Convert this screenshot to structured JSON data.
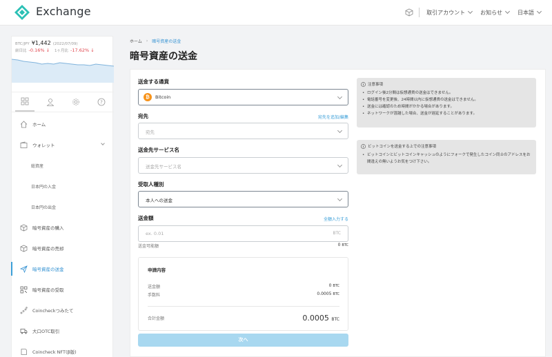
{
  "header": {
    "brand": "Exchange",
    "menus": [
      {
        "label": "取引アカウント"
      },
      {
        "label": "お知らせ"
      },
      {
        "label": "日本語"
      }
    ]
  },
  "rate": {
    "label1": "BTC/JPY",
    "price": "¥1,442",
    "date": "(2022/07/09)",
    "label2": "前日比",
    "change1": "-0.16% ↓",
    "label3": "1ヶ月比",
    "change2": "-17.62% ↓"
  },
  "sidebar": {
    "items": [
      {
        "label": "ホーム",
        "icon": "home-icon"
      },
      {
        "label": "ウォレット",
        "icon": "wallet-icon"
      },
      {
        "label": "総資産",
        "sub": true
      },
      {
        "label": "日本円の入金",
        "sub": true
      },
      {
        "label": "日本円の出金",
        "sub": true
      },
      {
        "label": "暗号資産の購入",
        "icon": "cube-icon"
      },
      {
        "label": "暗号資産の売却",
        "icon": "cube-icon"
      },
      {
        "label": "暗号資産の送金",
        "icon": "send-icon",
        "active": true
      },
      {
        "label": "暗号資産の受取",
        "icon": "qr-icon"
      },
      {
        "label": "Coincheckつみたて",
        "icon": "chart-icon"
      },
      {
        "label": "大口OTC取引",
        "icon": "truck-icon"
      },
      {
        "label": "Coincheck NFT(β版)",
        "icon": "nft-icon"
      }
    ]
  },
  "breadcrumb": {
    "home": "ホーム",
    "current": "暗号資産の送金"
  },
  "page_title": "暗号資産の送金",
  "form": {
    "currency_label": "送金する通貨",
    "currency_value": "Bitcoin",
    "dest_label": "宛先",
    "dest_link": "宛先を追加/編集",
    "dest_placeholder": "宛先",
    "service_label": "送金先サービス名",
    "service_placeholder": "送金先サービス名",
    "recipient_label": "受取人種別",
    "recipient_value": "本人への送金",
    "amount_label": "送金額",
    "amount_link": "全額入力する",
    "amount_placeholder": "ex. 0.01",
    "amount_unit": "BTC",
    "available_label": "送金可能額",
    "available_value": "0",
    "available_unit": "BTC",
    "next_label": "次へ"
  },
  "summary": {
    "title": "申請内容",
    "amount_label": "送金額",
    "amount_value": "0",
    "amount_unit": "BTC",
    "fee_label": "手数料",
    "fee_value": "0.0005",
    "fee_unit": "BTC",
    "total_label": "合計金額",
    "total_value": "0.0005",
    "total_unit": "BTC"
  },
  "notice1": {
    "title": "注意事項",
    "items": [
      "ログイン後2分間は仮想通貨の送金はできません。",
      "電話番号を変更後、24時間以内に仮想通貨の送金はできません。",
      "送金には確認のため時間がかかる場合があります。",
      "ネットワークが混雑した場合、送金が遅延することがあります。"
    ]
  },
  "notice2": {
    "title": "ビットコインを送金する上での注意事項",
    "items": [
      "ビットコインとビットコインキャッシュのようにフォークで発生したコイン同士のアドレスをお間違えの無いようお気をつけ下さい。"
    ]
  },
  "chart_data": {
    "type": "line",
    "values": [
      34,
      33,
      31,
      30,
      29,
      27,
      28,
      27,
      29,
      28,
      27,
      26,
      26,
      25,
      27,
      26,
      25,
      24
    ]
  }
}
